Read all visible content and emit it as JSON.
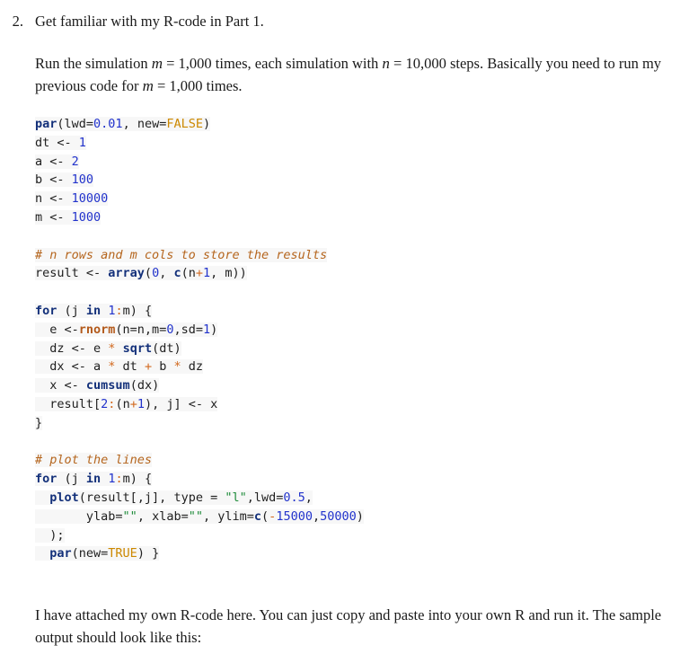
{
  "document": {
    "list_item": {
      "marker": "2.",
      "text": "Get familiar with my R-code in Part 1."
    },
    "paragraph_intro": {
      "seg1": "Run the simulation ",
      "var1": "m",
      "seg2": " = 1,000 times, each simulation with ",
      "var2": "n",
      "seg3": " = 10,000 steps. Basically you need to run my previous code for ",
      "var3": "m",
      "seg4": " = 1,000 times."
    },
    "paragraph_outro": {
      "text": "I have attached my own R-code here. You can just copy and paste into your own R and run it. The sample output should look like this:"
    },
    "code": {
      "language": "R",
      "lines": [
        {
          "tokens": [
            {
              "t": "par",
              "c": "t-fn"
            },
            {
              "t": "(",
              "c": "t-plain"
            },
            {
              "t": "lwd=",
              "c": "t-plain"
            },
            {
              "t": "0.01",
              "c": "t-num"
            },
            {
              "t": ", new=",
              "c": "t-plain"
            },
            {
              "t": "FALSE",
              "c": "t-const"
            },
            {
              "t": ")",
              "c": "t-plain"
            }
          ]
        },
        {
          "tokens": [
            {
              "t": "dt <- ",
              "c": "t-plain"
            },
            {
              "t": "1",
              "c": "t-num"
            }
          ]
        },
        {
          "tokens": [
            {
              "t": "a <- ",
              "c": "t-plain"
            },
            {
              "t": "2",
              "c": "t-num"
            }
          ]
        },
        {
          "tokens": [
            {
              "t": "b <- ",
              "c": "t-plain"
            },
            {
              "t": "100",
              "c": "t-num"
            }
          ]
        },
        {
          "tokens": [
            {
              "t": "n <- ",
              "c": "t-plain"
            },
            {
              "t": "10000",
              "c": "t-num"
            }
          ]
        },
        {
          "tokens": [
            {
              "t": "m <- ",
              "c": "t-plain"
            },
            {
              "t": "1000",
              "c": "t-num"
            }
          ]
        },
        {
          "blank": true
        },
        {
          "tokens": [
            {
              "t": "# n rows and m cols to store the results",
              "c": "t-comment"
            }
          ]
        },
        {
          "tokens": [
            {
              "t": "result <- ",
              "c": "t-plain"
            },
            {
              "t": "array",
              "c": "t-fn"
            },
            {
              "t": "(",
              "c": "t-plain"
            },
            {
              "t": "0",
              "c": "t-num"
            },
            {
              "t": ", ",
              "c": "t-plain"
            },
            {
              "t": "c",
              "c": "t-fn"
            },
            {
              "t": "(n",
              "c": "t-plain"
            },
            {
              "t": "+",
              "c": "t-op"
            },
            {
              "t": "1",
              "c": "t-num"
            },
            {
              "t": ", m))",
              "c": "t-plain"
            }
          ]
        },
        {
          "blank": true
        },
        {
          "tokens": [
            {
              "t": "for",
              "c": "t-kw"
            },
            {
              "t": " (j ",
              "c": "t-plain"
            },
            {
              "t": "in",
              "c": "t-kw"
            },
            {
              "t": " ",
              "c": "t-plain"
            },
            {
              "t": "1",
              "c": "t-num"
            },
            {
              "t": ":",
              "c": "t-op"
            },
            {
              "t": "m) {",
              "c": "t-plain"
            }
          ]
        },
        {
          "tokens": [
            {
              "t": "  e <-",
              "c": "t-plain"
            },
            {
              "t": "rnorm",
              "c": "t-fn2"
            },
            {
              "t": "(n=n,m=",
              "c": "t-plain"
            },
            {
              "t": "0",
              "c": "t-num"
            },
            {
              "t": ",sd=",
              "c": "t-plain"
            },
            {
              "t": "1",
              "c": "t-num"
            },
            {
              "t": ")",
              "c": "t-plain"
            }
          ]
        },
        {
          "tokens": [
            {
              "t": "  dz <- e ",
              "c": "t-plain"
            },
            {
              "t": "*",
              "c": "t-op"
            },
            {
              "t": " ",
              "c": "t-plain"
            },
            {
              "t": "sqrt",
              "c": "t-fn"
            },
            {
              "t": "(dt)",
              "c": "t-plain"
            }
          ]
        },
        {
          "tokens": [
            {
              "t": "  dx <- a ",
              "c": "t-plain"
            },
            {
              "t": "*",
              "c": "t-op"
            },
            {
              "t": " dt ",
              "c": "t-plain"
            },
            {
              "t": "+",
              "c": "t-op"
            },
            {
              "t": " b ",
              "c": "t-plain"
            },
            {
              "t": "*",
              "c": "t-op"
            },
            {
              "t": " dz",
              "c": "t-plain"
            }
          ]
        },
        {
          "tokens": [
            {
              "t": "  x <- ",
              "c": "t-plain"
            },
            {
              "t": "cumsum",
              "c": "t-fn"
            },
            {
              "t": "(dx)",
              "c": "t-plain"
            }
          ]
        },
        {
          "tokens": [
            {
              "t": "  result[",
              "c": "t-plain"
            },
            {
              "t": "2",
              "c": "t-num"
            },
            {
              "t": ":",
              "c": "t-op"
            },
            {
              "t": "(n",
              "c": "t-plain"
            },
            {
              "t": "+",
              "c": "t-op"
            },
            {
              "t": "1",
              "c": "t-num"
            },
            {
              "t": "), j] <- x",
              "c": "t-plain"
            }
          ]
        },
        {
          "tokens": [
            {
              "t": "}",
              "c": "t-plain"
            }
          ]
        },
        {
          "blank": true
        },
        {
          "tokens": [
            {
              "t": "# plot the lines",
              "c": "t-comment"
            }
          ]
        },
        {
          "tokens": [
            {
              "t": "for",
              "c": "t-kw"
            },
            {
              "t": " (j ",
              "c": "t-plain"
            },
            {
              "t": "in",
              "c": "t-kw"
            },
            {
              "t": " ",
              "c": "t-plain"
            },
            {
              "t": "1",
              "c": "t-num"
            },
            {
              "t": ":",
              "c": "t-op"
            },
            {
              "t": "m) {",
              "c": "t-plain"
            }
          ]
        },
        {
          "tokens": [
            {
              "t": "  ",
              "c": "t-plain"
            },
            {
              "t": "plot",
              "c": "t-fn"
            },
            {
              "t": "(result[,j], type = ",
              "c": "t-plain"
            },
            {
              "t": "\"l\"",
              "c": "t-str"
            },
            {
              "t": ",lwd=",
              "c": "t-plain"
            },
            {
              "t": "0.5",
              "c": "t-num"
            },
            {
              "t": ",",
              "c": "t-plain"
            }
          ]
        },
        {
          "tokens": [
            {
              "t": "       ylab=",
              "c": "t-plain"
            },
            {
              "t": "\"\"",
              "c": "t-str"
            },
            {
              "t": ", xlab=",
              "c": "t-plain"
            },
            {
              "t": "\"\"",
              "c": "t-str"
            },
            {
              "t": ", ylim=",
              "c": "t-plain"
            },
            {
              "t": "c",
              "c": "t-fn"
            },
            {
              "t": "(",
              "c": "t-plain"
            },
            {
              "t": "-",
              "c": "t-op"
            },
            {
              "t": "15000",
              "c": "t-num"
            },
            {
              "t": ",",
              "c": "t-plain"
            },
            {
              "t": "50000",
              "c": "t-num"
            },
            {
              "t": ")",
              "c": "t-plain"
            }
          ]
        },
        {
          "tokens": [
            {
              "t": "  );",
              "c": "t-plain"
            }
          ]
        },
        {
          "tokens": [
            {
              "t": "  ",
              "c": "t-plain"
            },
            {
              "t": "par",
              "c": "t-fn"
            },
            {
              "t": "(new=",
              "c": "t-plain"
            },
            {
              "t": "TRUE",
              "c": "t-const"
            },
            {
              "t": ") }",
              "c": "t-plain"
            }
          ]
        }
      ]
    },
    "colors": {
      "background": "#ffffff",
      "text": "#1a1a1a",
      "code_keyword": "#13307a",
      "code_function": "#13307a",
      "code_function_alt": "#b3591a",
      "code_number": "#2233cc",
      "code_operator": "#d2691e",
      "code_constant": "#cc8800",
      "code_string": "#1e8c3a",
      "code_comment": "#b5651d",
      "code_line_bg": "#f7f7f7"
    }
  }
}
